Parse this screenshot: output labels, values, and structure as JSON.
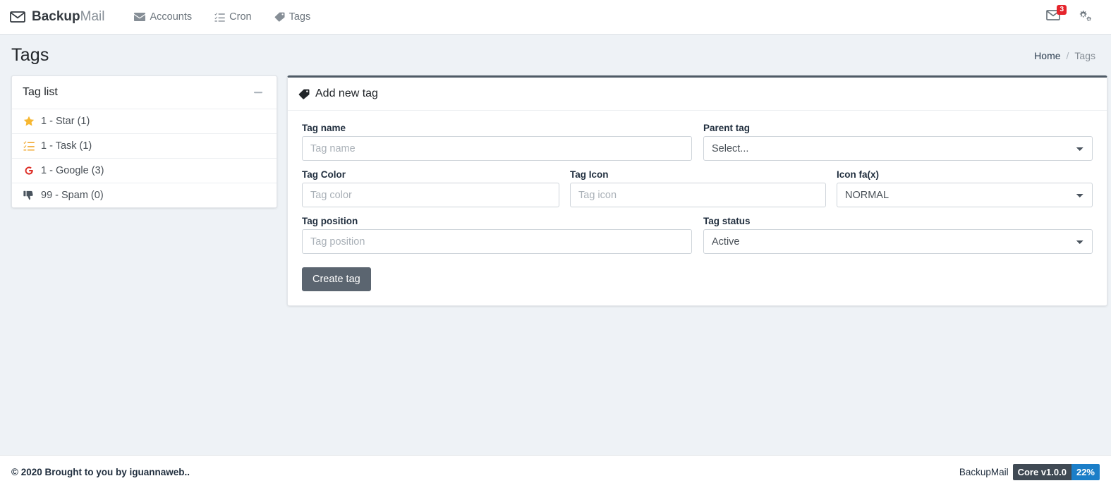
{
  "navbar": {
    "brand": {
      "icon": "envelope-icon",
      "strong": "Backup",
      "light": "Mail"
    },
    "links": [
      {
        "icon": "envelope-icon",
        "label": "Accounts"
      },
      {
        "icon": "tasks-icon",
        "label": "Cron"
      },
      {
        "icon": "tag-icon",
        "label": "Tags"
      }
    ],
    "right": {
      "messages_icon": "envelope-icon",
      "messages_count": "3",
      "settings_icon": "cogs-icon"
    }
  },
  "content_header": {
    "title": "Tags",
    "breadcrumb": {
      "home": "Home",
      "separator": "/",
      "current": "Tags"
    }
  },
  "tag_list_card": {
    "title": "Tag list",
    "collapse_icon": "minus-icon",
    "items": [
      {
        "icon": "star-icon",
        "icon_color": "#f7b731",
        "label": "1 - Star (1)"
      },
      {
        "icon": "tasks-icon",
        "icon_color": "#f0a830",
        "label": "1 - Task (1)"
      },
      {
        "icon": "google-icon",
        "icon_color": "#dd2c24",
        "label": "1 - Google (3)"
      },
      {
        "icon": "thumbs-down-icon",
        "icon_color": "#4a545e",
        "label": "99 - Spam (0)"
      }
    ]
  },
  "form_card": {
    "title": "Add new tag",
    "title_icon": "tag-icon",
    "fields": {
      "tag_name": {
        "label": "Tag name",
        "placeholder": "Tag name",
        "value": ""
      },
      "parent_tag": {
        "label": "Parent tag",
        "selected": "Select..."
      },
      "tag_color": {
        "label": "Tag Color",
        "placeholder": "Tag color",
        "value": ""
      },
      "tag_icon": {
        "label": "Tag Icon",
        "placeholder": "Tag icon",
        "value": ""
      },
      "icon_fax": {
        "label": "Icon fa(x)",
        "selected": "NORMAL"
      },
      "tag_position": {
        "label": "Tag position",
        "placeholder": "Tag position",
        "value": ""
      },
      "tag_status": {
        "label": "Tag status",
        "selected": "Active"
      }
    },
    "submit_label": "Create tag"
  },
  "footer": {
    "copyright": "© 2020",
    "credit": "Brought to you by iguannaweb..",
    "brand": "BackupMail",
    "version_badge": "Core v1.0.0",
    "percent_badge": "22%"
  },
  "colors": {
    "accent_dark": "#4f5b66",
    "badge_red": "#e5242c",
    "badge_blue": "#1b7ec8",
    "badge_dark": "#404a54",
    "page_bg": "#eef2f6"
  }
}
